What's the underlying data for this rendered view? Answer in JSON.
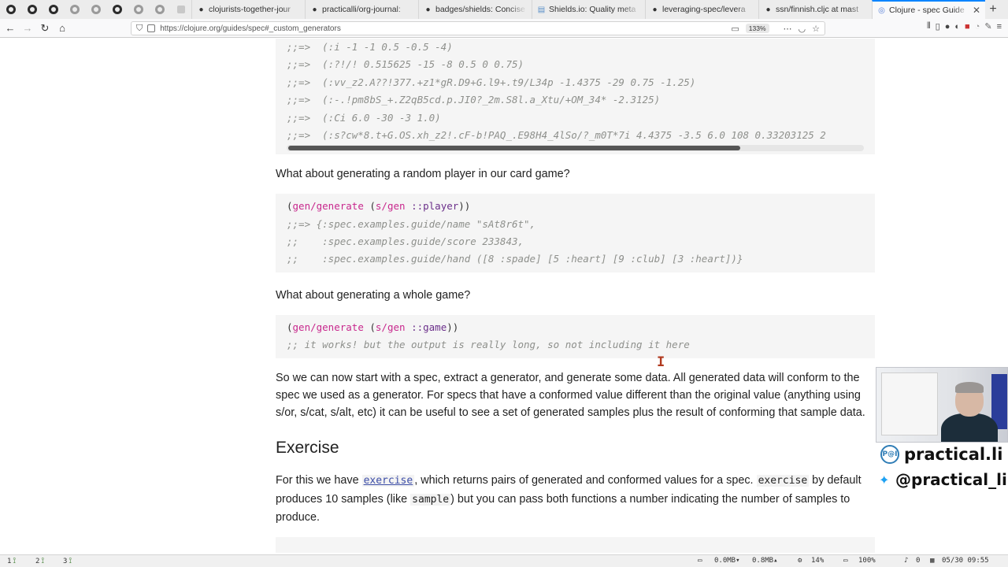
{
  "browser": {
    "tabs": [
      {
        "title": "clojurists-together-jour",
        "icon": "github-icon"
      },
      {
        "title": "practicalli/org-journal:",
        "icon": "github-icon"
      },
      {
        "title": "badges/shields: Concise",
        "icon": "github-icon"
      },
      {
        "title": "Shields.io: Quality meta",
        "icon": "shields-icon"
      },
      {
        "title": "leveraging-spec/levera",
        "icon": "github-icon"
      },
      {
        "title": "ssn/finnish.cljc at mast",
        "icon": "github-icon"
      },
      {
        "title": "Clojure - spec Guide",
        "icon": "clojure-icon",
        "active": true
      }
    ],
    "url": "https://clojure.org/guides/spec#_custom_generators",
    "zoom": "133%"
  },
  "page": {
    "code1": [
      ";;=>  (:i -1 -1 0.5 -0.5 -4)",
      ";;=>  (:?!/! 0.515625 -15 -8 0.5 0 0.75)",
      ";;=>  (:vv_z2.A??!377.+z1*gR.D9+G.l9+.t9/L34p -1.4375 -29 0.75 -1.25)",
      ";;=>  (:-.!pm8bS_+.Z2qB5cd.p.JI0?_2m.S8l.a_Xtu/+OM_34* -2.3125)",
      ";;=>  (:Ci 6.0 -30 -3 1.0)",
      ";;=>  (:s?cw*8.t+G.OS.xh_z2!.cF-b!PAQ_.E98H4_4lSo/?_m0T*7i 4.4375 -3.5 6.0 108 0.33203125 2"
    ],
    "p1": "What about generating a random player in our card game?",
    "code2": {
      "call_open": "(",
      "fn": "gen/generate",
      "inner_open": " (",
      "fn2": "s/gen",
      "kw": " ::player",
      "close": "))",
      "results": [
        ";;=> {:spec.examples.guide/name \"sAt8r6t\",",
        ";;    :spec.examples.guide/score 233843,",
        ";;    :spec.examples.guide/hand ([8 :spade] [5 :heart] [9 :club] [3 :heart])}"
      ]
    },
    "p2": "What about generating a whole game?",
    "code3": {
      "call_open": "(",
      "fn": "gen/generate",
      "inner_open": " (",
      "fn2": "s/gen",
      "kw": " ::game",
      "close": "))",
      "comment": ";; it works! but the output is really long, so not including it here"
    },
    "p3": "So we can now start with a spec, extract a generator, and generate some data. All generated data will conform to the spec we used as a generator. For specs that have a conformed value different than the original value (anything using s/or, s/cat, s/alt, etc) it can be useful to see a set of generated samples plus the result of conforming that sample data.",
    "heading": "Exercise",
    "p4": {
      "t1": "For this we have ",
      "link": "exercise",
      "t2": ", which returns pairs of generated and conformed values for a spec. ",
      "code1": "exercise",
      "t3": " by default produces 10 samples (like ",
      "code2": "sample",
      "t4": ") but you can pass both functions a number indicating the number of samples to produce."
    }
  },
  "overlay": {
    "handle1": "practical.li",
    "handle2": "@practical_li",
    "logo_text": "P@I"
  },
  "statusbar": {
    "ws1": "1",
    "ws2": "2",
    "ws3": "3",
    "net_down": "0.0MB",
    "net_up": "0.8MB",
    "cpu": "14%",
    "battery": "100%",
    "notifications": "0",
    "datetime": "05/30 09:55"
  }
}
